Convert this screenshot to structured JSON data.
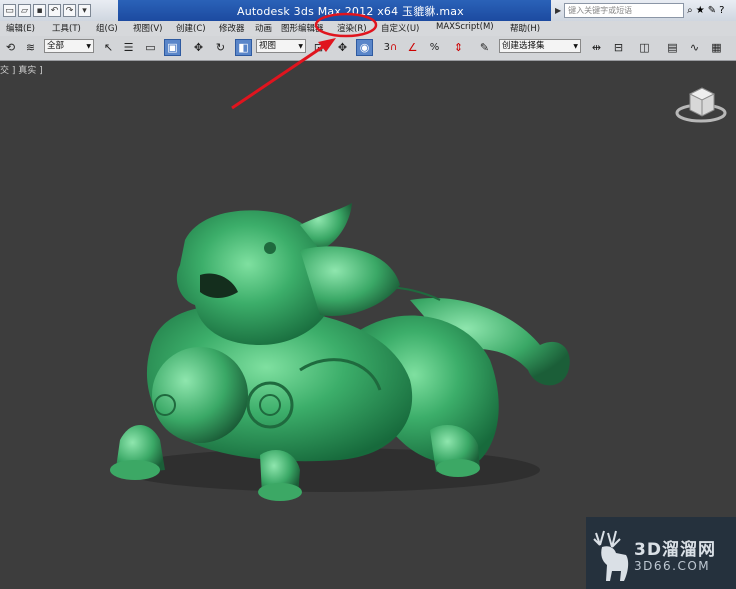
{
  "window": {
    "title": "Autodesk 3ds Max  2012 x64     玉貔貅.max",
    "search_placeholder": "键入关键字或短语"
  },
  "menu": [
    {
      "label": "编辑(E)"
    },
    {
      "label": "工具(T)"
    },
    {
      "label": "组(G)"
    },
    {
      "label": "视图(V)"
    },
    {
      "label": "创建(C)"
    },
    {
      "label": "修改器"
    },
    {
      "label": "动画"
    },
    {
      "label": "图形编辑器"
    },
    {
      "label": "渲染(R)"
    },
    {
      "label": "自定义(U)"
    },
    {
      "label": "MAXScript(M)"
    },
    {
      "label": "帮助(H)"
    }
  ],
  "toolbar": {
    "selection_filter": "全部",
    "reference_coord": "视图",
    "named_selection": "创建选择集",
    "snap_3": "3",
    "percent_snap": "%"
  },
  "viewport": {
    "label": "[ + ] [ 顶 ] [ 真实 ]",
    "label_visible": "交 ] 真实 ]"
  },
  "watermark": {
    "line1": "3D溜溜网",
    "line2": "3D66.COM"
  },
  "colors": {
    "title_bar": "#1c4aa0",
    "viewport_bg": "#3d3d3d",
    "jade": "#3cae6a",
    "annotation_red": "#e0141e"
  }
}
